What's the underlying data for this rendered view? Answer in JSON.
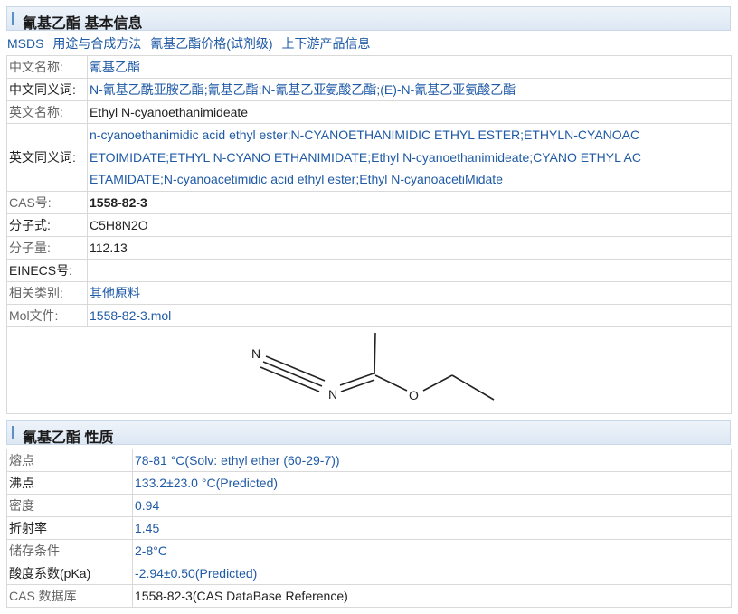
{
  "section1": {
    "title": "氰基乙酯 基本信息"
  },
  "links": [
    "MSDS",
    "用途与合成方法",
    "氰基乙酯价格(试剂级)",
    "上下游产品信息"
  ],
  "basic": {
    "cn_name": {
      "label": "中文名称:",
      "value": "氰基乙酯"
    },
    "cn_synonyms": {
      "label": "中文同义词:",
      "value": "N-氰基乙酰亚胺乙酯;氰基乙酯;N-氰基乙亚氨酸乙酯;(E)-N-氰基乙亚氨酸乙酯"
    },
    "en_name": {
      "label": "英文名称:",
      "value": "Ethyl N-cyanoethanimideate"
    },
    "en_synonyms": {
      "label": "英文同义词:",
      "line1": "n-cyanoethanimidic acid ethyl ester;N-CYANOETHANIMIDIC ETHYL ESTER;ETHYLN-CYANOAC",
      "line2": "ETOIMIDATE;ETHYL N-CYANO ETHANIMIDATE;Ethyl N-cyanoethanimideate;CYANO ETHYL AC",
      "line3": "ETAMIDATE;N-cyanoacetimidic acid ethyl ester;Ethyl N-cyanoacetiMidate"
    },
    "cas": {
      "label": "CAS号:",
      "value": "1558-82-3"
    },
    "formula": {
      "label": "分子式:",
      "value": "C5H8N2O"
    },
    "mw": {
      "label": "分子量:",
      "value": "112.13"
    },
    "einecs": {
      "label": "EINECS号:",
      "value": ""
    },
    "category": {
      "label": "相关类别:",
      "value": "其他原料"
    },
    "mol": {
      "label": "Mol文件:",
      "value": "1558-82-3.mol"
    }
  },
  "structure": {
    "atom_n1": "N",
    "atom_n2": "N",
    "atom_o": "O"
  },
  "section2": {
    "title": "氰基乙酯 性质"
  },
  "properties": [
    {
      "label": "熔点",
      "value": "78-81 °C(Solv: ethyl ether (60-29-7))",
      "dark": false
    },
    {
      "label": "沸点",
      "value": "133.2±23.0 °C(Predicted)",
      "dark": true
    },
    {
      "label": "密度",
      "value": "0.94",
      "dark": false
    },
    {
      "label": "折射率",
      "value": "1.45",
      "dark": true
    },
    {
      "label": "储存条件",
      "value": "2-8°C",
      "dark": false
    },
    {
      "label": "酸度系数(pKa)",
      "value": "-2.94±0.50(Predicted)",
      "dark": true
    },
    {
      "label": "CAS 数据库",
      "value": "1558-82-3(CAS DataBase Reference)",
      "dark": false
    }
  ],
  "colors": {
    "link": "#1f5aa6",
    "header_bar": "#5b8fc7"
  }
}
